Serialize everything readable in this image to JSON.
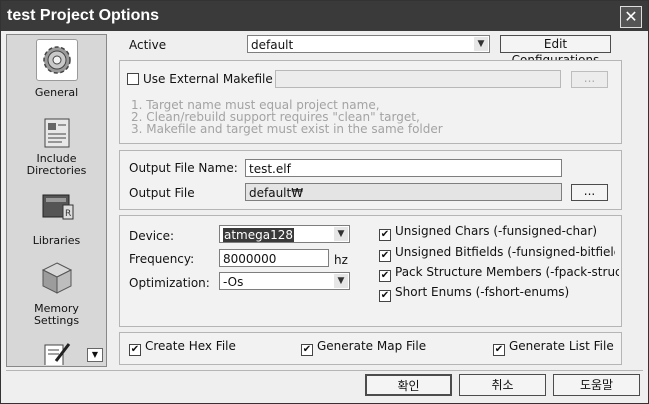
{
  "window": {
    "title": "test Project Options",
    "close_glyph": "✕"
  },
  "sidebar": {
    "items": [
      {
        "label": "General",
        "icon": "gear-icon",
        "selected": true
      },
      {
        "label": "Include\nDirectories",
        "icon": "include-directories-icon"
      },
      {
        "label": "Libraries",
        "icon": "libraries-icon"
      },
      {
        "label": "Memory\nSettings",
        "icon": "memory-settings-icon"
      },
      {
        "label": "",
        "icon": "custom-options-icon"
      }
    ],
    "scroll_glyph": "▼"
  },
  "active": {
    "label": "Active",
    "value": "default",
    "edit_button": "Edit Configurations"
  },
  "makefile": {
    "checkbox_label": "Use External Makefile",
    "checked": false,
    "path": "",
    "browse_label": "...",
    "hints": [
      "1. Target name must equal project name,",
      "2. Clean/rebuild support requires  \"clean\" target,",
      "3. Makefile and target must exist in the same folder"
    ]
  },
  "output": {
    "file_name_label": "Output File Name:",
    "file_name_value": "test.elf",
    "file_label": "Output File",
    "file_value": "default₩",
    "browse_label": "..."
  },
  "device": {
    "device_label": "Device:",
    "device_value": "atmega128",
    "frequency_label": "Frequency:",
    "frequency_value": "8000000",
    "frequency_unit": "hz",
    "optimization_label": "Optimization:",
    "optimization_value": "-Os"
  },
  "flags": [
    {
      "label": "Unsigned Chars (-funsigned-char)",
      "checked": true
    },
    {
      "label": "Unsigned Bitfields (-funsigned-bitfields",
      "checked": true
    },
    {
      "label": "Pack Structure Members (-fpack-struct)",
      "checked": true
    },
    {
      "label": "Short Enums (-fshort-enums)",
      "checked": true
    }
  ],
  "outputs": [
    {
      "label": "Create Hex File",
      "checked": true
    },
    {
      "label": "Generate Map File",
      "checked": true
    },
    {
      "label": "Generate List File",
      "checked": true
    }
  ],
  "buttons": {
    "ok": "확인",
    "cancel": "취소",
    "help": "도움말"
  },
  "check_glyph": "✔"
}
